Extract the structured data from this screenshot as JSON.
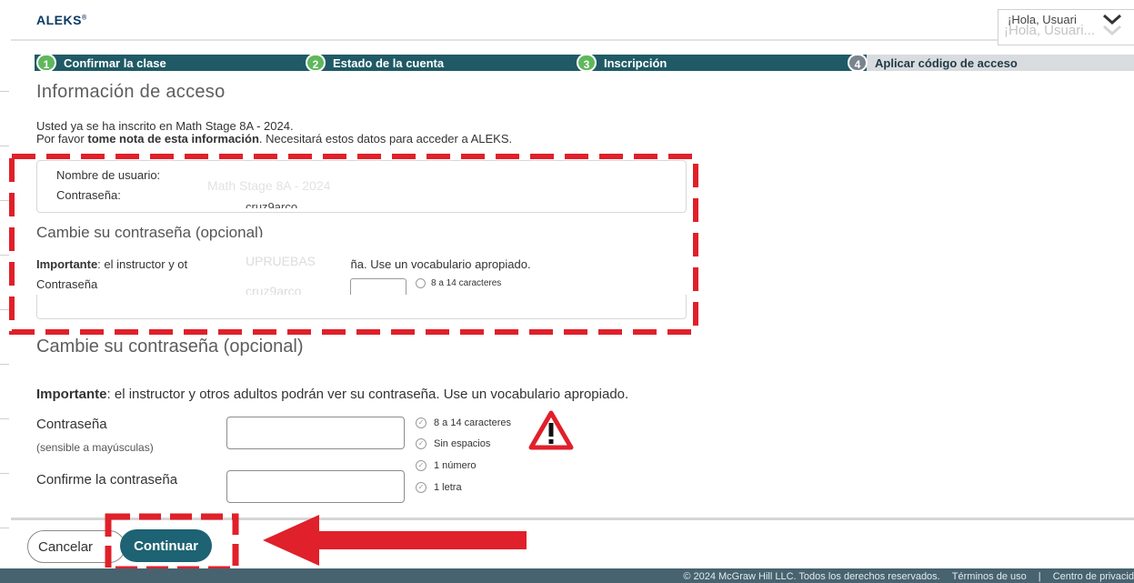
{
  "header": {
    "logo": "ALEKS",
    "logo_mark": "®",
    "user_greeting": "¡Hola, Usuari",
    "user_greeting_ghost": "¡Hola, Usuari..."
  },
  "stepper": {
    "steps": [
      {
        "num": "1",
        "label": "Confirmar la clase",
        "state": "done"
      },
      {
        "num": "2",
        "label": "Estado de la cuenta",
        "state": "done"
      },
      {
        "num": "3",
        "label": "Inscripción",
        "state": "current"
      },
      {
        "num": "4",
        "label": "Aplicar código de acceso",
        "state": "pending"
      }
    ]
  },
  "main": {
    "title": "Información de acceso",
    "enrolled_text": "Usted ya se ha inscrito en Math Stage 8A - 2024.",
    "note_prefix": "Por favor ",
    "note_bold": "tome nota de esta información",
    "note_suffix": ". Necesitará estos datos para acceder a ALEKS.",
    "credentials": {
      "username_label": "Nombre de usuario:",
      "password_label": "Contraseña:",
      "ghost_class": "Math Stage 8A - 2024",
      "ghost_password": "cruz9arco",
      "ghost_username": "UPRUEBAS",
      "ghost_password2": "cruz9arco"
    },
    "ghost_change_title": "Cambie su contraseña (opcional)",
    "ghost_important_bold": "Importante",
    "ghost_important_a": ": el instructor y ot",
    "ghost_important_b": "er su contraseña. Use un vocabulario apropiado.",
    "ghost_password_label": "Contraseña",
    "ghost_rule": "8 a 14 caracteres"
  },
  "change_password": {
    "title": "Cambie su contraseña (opcional)",
    "important_bold": "Importante",
    "important_text": ": el instructor y otros adultos podrán ver su contraseña. Use un vocabulario apropiado.",
    "password_label": "Contraseña",
    "password_hint": "(sensible a mayúsculas)",
    "password_value": "",
    "confirm_label": "Confirme la contraseña",
    "confirm_value": "",
    "rules": [
      "8 a 14 caracteres",
      "Sin espacios",
      "1 número",
      "1 letra"
    ]
  },
  "actions": {
    "cancel_label": "Cancelar",
    "continue_label": "Continuar"
  },
  "footer": {
    "copyright": "© 2024 McGraw Hill LLC. Todos los derechos reservados.",
    "terms": "Términos de uso",
    "separator": "|",
    "privacy": "Centro de privacid"
  },
  "annotation_colors": {
    "red": "#e0202a",
    "teal": "#1d6373",
    "green": "#5fb85c"
  }
}
